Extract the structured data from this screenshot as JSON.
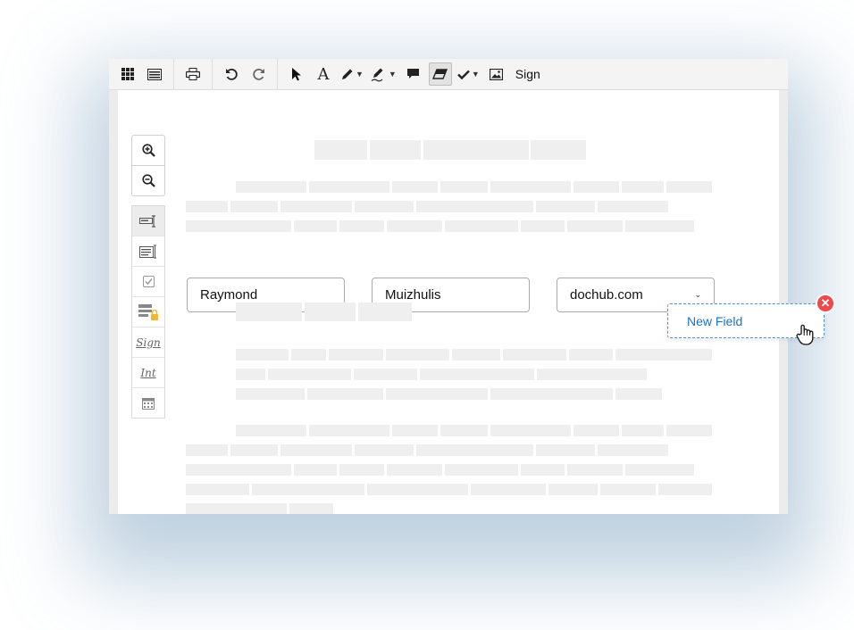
{
  "toolbar": {
    "groups": [
      [
        "grid-icon",
        "list-view-icon"
      ],
      [
        "print-icon"
      ],
      [
        "undo-icon",
        "redo-icon"
      ],
      [
        "pointer-icon",
        "text-icon",
        "pen-icon",
        "highlighter-icon",
        "comment-icon",
        "eraser-icon",
        "check-icon",
        "image-icon"
      ]
    ],
    "sign_label": "Sign",
    "active_tool": "eraser-icon"
  },
  "sidebar": {
    "zoom": [
      "zoom-in-icon",
      "zoom-out-icon"
    ],
    "tools": [
      "text-field-icon",
      "text-block-icon",
      "checkbox-icon",
      "locked-field-icon",
      "signature-icon",
      "initials-icon",
      "date-icon"
    ],
    "signature_text": "Sign",
    "initials_text": "Int"
  },
  "form": {
    "first_name": "Raymond",
    "last_name": "Muizhulis",
    "domain": "dochub.com"
  },
  "new_field": {
    "label": "New Field"
  },
  "colors": {
    "accent": "#1a73c8",
    "close": "#f04848",
    "placeholder": "#efefef"
  }
}
